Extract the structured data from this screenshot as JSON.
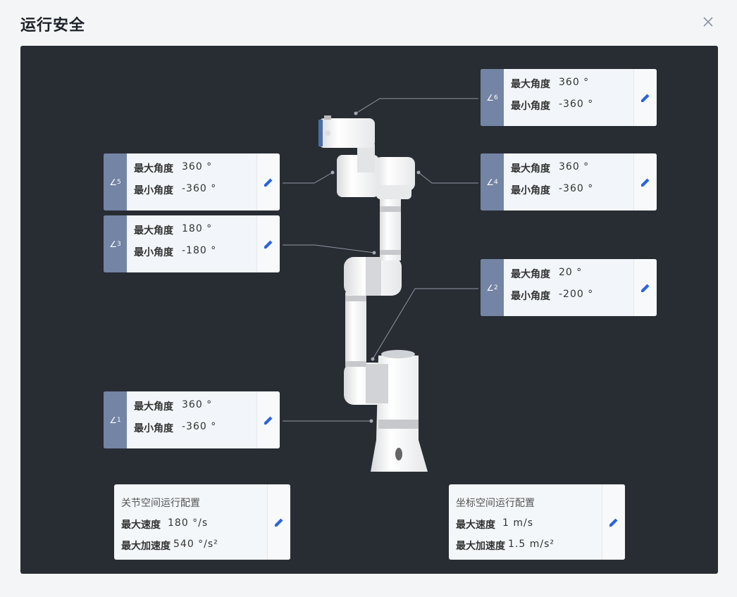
{
  "dialog": {
    "title": "运行安全"
  },
  "labels": {
    "max_angle": "最大角度",
    "min_angle": "最小角度",
    "max_speed": "最大速度",
    "max_accel": "最大加速度"
  },
  "joints": [
    {
      "tag": "∠",
      "num": "6",
      "max": "360 °",
      "min": "-360 °"
    },
    {
      "tag": "∠",
      "num": "5",
      "max": "360 °",
      "min": "-360 °"
    },
    {
      "tag": "∠",
      "num": "4",
      "max": "360 °",
      "min": "-360 °"
    },
    {
      "tag": "∠",
      "num": "3",
      "max": "180 °",
      "min": "-180 °"
    },
    {
      "tag": "∠",
      "num": "2",
      "max": "20 °",
      "min": "-200 °"
    },
    {
      "tag": "∠",
      "num": "1",
      "max": "360 °",
      "min": "-360 °"
    }
  ],
  "configs": [
    {
      "title": "关节空间运行配置",
      "max_speed": "180 °/s",
      "max_accel": "540 °/s²"
    },
    {
      "title": "坐标空间运行配置",
      "max_speed": "1 m/s",
      "max_accel": "1.5 m/s²"
    }
  ],
  "colors": {
    "panel_bg": "#282c33",
    "tag_bg": "#7384a4",
    "edit_icon": "#2b63e0"
  },
  "icons": {
    "close": "close-icon",
    "edit": "pencil-icon"
  }
}
